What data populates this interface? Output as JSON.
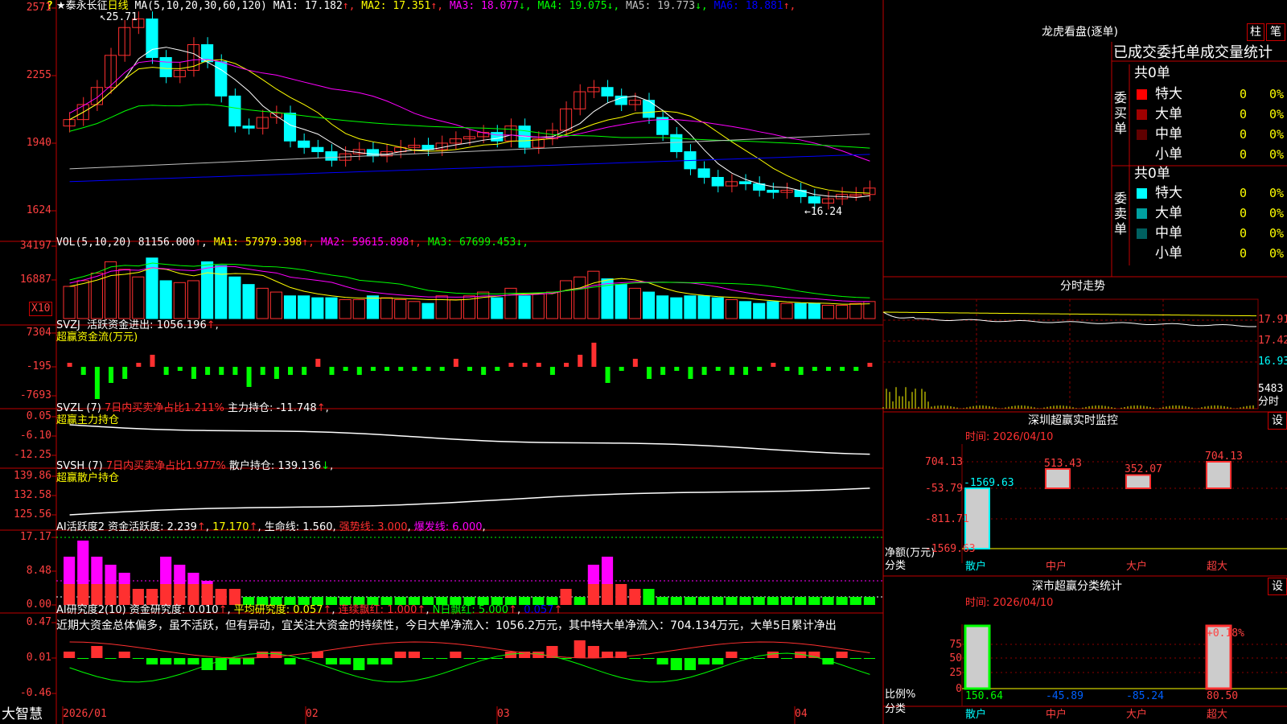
{
  "stock": {
    "name": "★泰永长征",
    "period": "日线"
  },
  "colors": {
    "up": "#ff3030",
    "down": "#00ffff",
    "grid": "#8b0000",
    "frame": "#c00000",
    "yellow": "#ffff00",
    "magenta": "#ff00ff",
    "green": "#00ff00",
    "white": "#ffffff",
    "blue": "#0000ff",
    "gray": "#c0c0c0"
  },
  "panels": {
    "main": {
      "label": "MA(5,10,20,30,60,120)",
      "axis": [
        "2571",
        "2255",
        "1940",
        "1624"
      ],
      "max_label": "25.71",
      "min_label": "16.24",
      "lines": [
        {
          "name": "MA1",
          "value": "17.182",
          "arrow": "↑",
          "color": "#ffffff"
        },
        {
          "name": "MA2",
          "value": "17.351",
          "arrow": "↑",
          "color": "#ffff00"
        },
        {
          "name": "MA3",
          "value": "18.077",
          "arrow": "↓",
          "color": "#ff00ff"
        },
        {
          "name": "MA4",
          "value": "19.075",
          "arrow": "↓",
          "color": "#00ff00"
        },
        {
          "name": "MA5",
          "value": "19.773",
          "arrow": "↓",
          "color": "#c0c0c0"
        },
        {
          "name": "MA6",
          "value": "18.881",
          "arrow": "↑",
          "color": "#0000ff"
        }
      ]
    },
    "vol": {
      "label": "VOL(5,10,20)",
      "value": "81156.000",
      "arrow": "↑",
      "lines": [
        {
          "name": "MA1",
          "value": "57979.398",
          "arrow": "↑",
          "color": "#ffff00"
        },
        {
          "name": "MA2",
          "value": "59615.898",
          "arrow": "↑",
          "color": "#ff00ff"
        },
        {
          "name": "MA3",
          "value": "67699.453",
          "arrow": "↓",
          "color": "#00ff00"
        }
      ],
      "axis": [
        "34197",
        "16887"
      ],
      "unit": "X10"
    },
    "svzj": {
      "label": "SVZJ",
      "sub": "活跃资金进出:",
      "value": "1056.196",
      "arrow": "↑",
      "title2": "超赢资金流(万元)",
      "axis": [
        "7304",
        "-195",
        "-7693"
      ]
    },
    "svzl": {
      "label": "SVZL (7)",
      "t1": "7日内买卖净占比1.211%",
      "t2": "主力持仓:",
      "value": "-11.748",
      "arrow": "↑",
      "title2": "超赢主力持仓",
      "axis": [
        "0.05",
        "-6.10",
        "-12.25"
      ]
    },
    "svsh": {
      "label": "SVSH (7)",
      "t1": "7日内买卖净占比1.977%",
      "t2": "散户持仓:",
      "value": "139.136",
      "arrow": "↓",
      "title2": "超赢散户持仓",
      "axis": [
        "139.86",
        "132.58",
        "125.56"
      ]
    },
    "ai1": {
      "label": "AI活跃度2",
      "t1": "资金活跃度:",
      "v1": "2.239",
      "v2": "17.170",
      "t3": "生命线:",
      "v3": "1.560",
      "t4": "强势线:",
      "v4": "3.000",
      "t5": "爆发线:",
      "v5": "6.000",
      "axis": [
        "17.17",
        "8.48",
        "0.00"
      ]
    },
    "ai2": {
      "label": "AI研究度2(10)",
      "t1": "资金研究度:",
      "v1": "0.010",
      "t2": "平均研究度:",
      "v2": "0.057",
      "t3": "连续飘红:",
      "v3": "1.000",
      "t4": "N日飘红:",
      "v4": "5.000",
      "v5": "0.057",
      "axis": [
        "0.47",
        "0.01",
        "-0.46"
      ],
      "commentary": "近期大资金总体偏多，虽不活跃，但有异动，宜关注大资金的持续性，今日大单净流入：1056.2万元，其中特大单净流入：704.134万元，大单5日累计净出"
    }
  },
  "xaxis": [
    "2026/01",
    "02",
    "03",
    "04"
  ],
  "brand": "大智慧",
  "right": {
    "longhu": {
      "title": "龙虎看盘(逐单)",
      "btn1": "柱",
      "btn2": "笔",
      "header": "已成交委托单成交量统计",
      "buy": {
        "label": "委买单",
        "total": "共0单",
        "rows": [
          {
            "name": "特大",
            "count": "0",
            "pct": "0%",
            "color": "#ff0000"
          },
          {
            "name": "大单",
            "count": "0",
            "pct": "0%",
            "color": "#a00000"
          },
          {
            "name": "中单",
            "count": "0",
            "pct": "0%",
            "color": "#600000"
          },
          {
            "name": "小单",
            "count": "0",
            "pct": "0%",
            "color": ""
          }
        ]
      },
      "sell": {
        "label": "委卖单",
        "total": "共0单",
        "rows": [
          {
            "name": "特大",
            "count": "0",
            "pct": "0%",
            "color": "#00ffff"
          },
          {
            "name": "大单",
            "count": "0",
            "pct": "0%",
            "color": "#00a0a0"
          },
          {
            "name": "中单",
            "count": "0",
            "pct": "0%",
            "color": "#006060"
          },
          {
            "name": "小单",
            "count": "0",
            "pct": "0%",
            "color": ""
          }
        ]
      }
    },
    "fenshi": {
      "title": "分时走势",
      "axis": [
        "17.91",
        "17.42",
        "16.93"
      ],
      "vol_label": "5483",
      "vol_unit": "分时"
    },
    "monitor": {
      "title": "深圳超赢实时监控",
      "btn": "设",
      "time": "时间: 2026/04/10",
      "axis": [
        "704.13",
        "-53.79",
        "-811.71",
        "-1569.63"
      ],
      "ylabel": "净额(万元)",
      "xlabel": "分类",
      "cats": [
        "散户",
        "中户",
        "大户",
        "超大"
      ],
      "values": [
        -1569.63,
        513.43,
        352.07,
        704.13
      ],
      "labels": [
        "-1569.63",
        "513.43",
        "352.07",
        "704.13"
      ]
    },
    "classify": {
      "title": "深市超赢分类统计",
      "btn": "设",
      "time": "时间: 2026/04/10",
      "axis": [
        "75",
        "50",
        "25",
        "0"
      ],
      "ylabel": "比例%",
      "xlabel": "分类",
      "cats": [
        "散户",
        "中户",
        "大户",
        "超大"
      ],
      "values": [
        150.64,
        -45.89,
        -85.24,
        80.5
      ],
      "labels": [
        "150.64",
        "-45.89",
        "-85.24",
        "80.50"
      ],
      "top_label": "+0.18%"
    }
  }
}
